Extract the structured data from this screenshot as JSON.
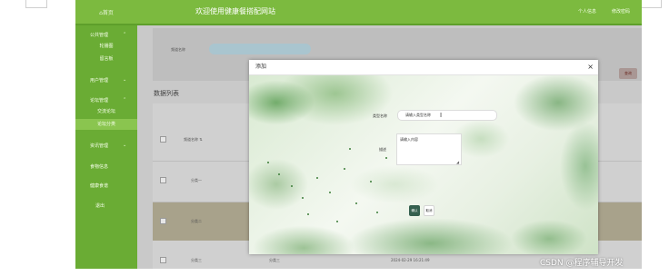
{
  "header": {
    "home_label": "⌂首页",
    "title": "欢迎使用健康餐搭配网站",
    "profile_link": "个人信息",
    "password_link": "修改密码"
  },
  "sidebar": {
    "items": [
      {
        "label": "公共管理",
        "expanded": true
      },
      {
        "label": "轮播图",
        "sub": true
      },
      {
        "label": "留言板",
        "sub": true
      },
      {
        "label": "用户管理",
        "expanded": false
      },
      {
        "label": "论坛管理",
        "expanded": true
      },
      {
        "label": "交流论坛",
        "sub": true
      },
      {
        "label": "论坛分类",
        "sub": true,
        "active": true
      },
      {
        "label": "资讯管理",
        "expanded": false
      },
      {
        "label": "食物信息"
      },
      {
        "label": "健康食谱"
      },
      {
        "label": "退出"
      }
    ]
  },
  "search": {
    "label": "频道名称",
    "value": "",
    "search_button": "查询"
  },
  "list": {
    "title": "数据列表",
    "columns": [
      "频道名称 ⇅"
    ],
    "rows": [
      {
        "name": "分类一"
      },
      {
        "name": "分类二",
        "selected": true
      },
      {
        "name": "分类三",
        "extra": "分类三",
        "time": "2024-02-29 16:21:49"
      }
    ]
  },
  "dialog": {
    "title": "添加",
    "close": "×",
    "type_label": "类型名称",
    "type_value": "请输入类型名称",
    "desc_label": "描述",
    "desc_placeholder": "请输入内容",
    "ok_button": "确认",
    "cancel_button": "取消"
  },
  "watermark": "CSDN @程序辅导开发",
  "colors": {
    "topbar": "#7cba3f",
    "sidebar": "#6aac34",
    "ok_button": "#35604f",
    "selected_row": "#a8a28b"
  }
}
